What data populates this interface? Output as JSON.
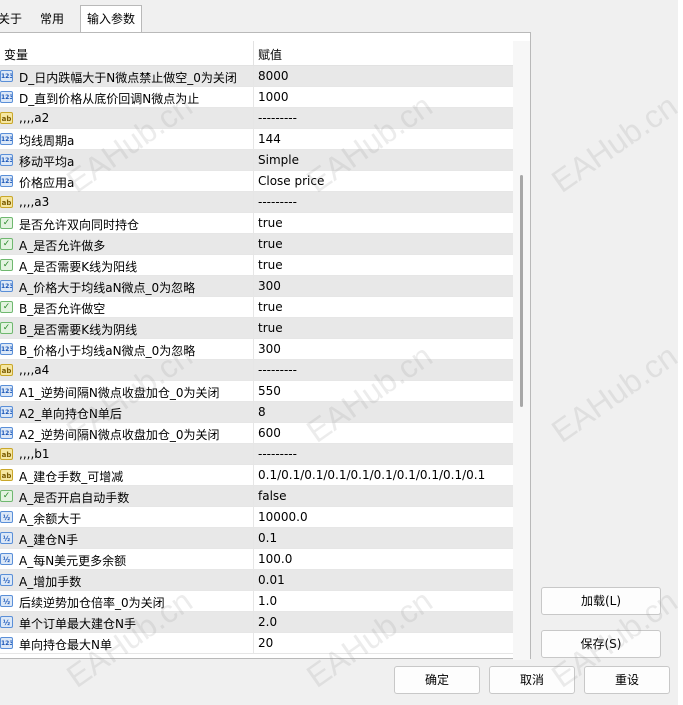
{
  "tabs": [
    {
      "label": "关于"
    },
    {
      "label": "常用"
    },
    {
      "label": "输入参数"
    }
  ],
  "table": {
    "header_variable": "变量",
    "header_value": "赋值",
    "rows": [
      {
        "type": "int",
        "icon": "123",
        "name": "D_日内跌幅大于N微点禁止做空_0为关闭",
        "value": "8000"
      },
      {
        "type": "int",
        "icon": "123",
        "name": "D_直到价格从底价回调N微点为止",
        "value": "1000"
      },
      {
        "type": "str",
        "icon": "ab",
        "name": ",,,,a2",
        "value": "---------"
      },
      {
        "type": "int",
        "icon": "123",
        "name": "均线周期a",
        "value": "144"
      },
      {
        "type": "int",
        "icon": "123",
        "name": "移动平均a",
        "value": "Simple"
      },
      {
        "type": "int",
        "icon": "123",
        "name": "价格应用a",
        "value": "Close price"
      },
      {
        "type": "str",
        "icon": "ab",
        "name": ",,,,a3",
        "value": "---------"
      },
      {
        "type": "bool",
        "icon": "✓",
        "name": "是否允许双向同时持仓",
        "value": "true"
      },
      {
        "type": "bool",
        "icon": "✓",
        "name": "A_是否允许做多",
        "value": "true"
      },
      {
        "type": "bool",
        "icon": "✓",
        "name": "A_是否需要K线为阳线",
        "value": "true"
      },
      {
        "type": "int",
        "icon": "123",
        "name": "A_价格大于均线aN微点_0为忽略",
        "value": "300"
      },
      {
        "type": "bool",
        "icon": "✓",
        "name": "B_是否允许做空",
        "value": "true"
      },
      {
        "type": "bool",
        "icon": "✓",
        "name": "B_是否需要K线为阴线",
        "value": "true"
      },
      {
        "type": "int",
        "icon": "123",
        "name": "B_价格小于均线aN微点_0为忽略",
        "value": "300"
      },
      {
        "type": "str",
        "icon": "ab",
        "name": ",,,,a4",
        "value": "---------"
      },
      {
        "type": "int",
        "icon": "123",
        "name": "A1_逆势间隔N微点收盘加仓_0为关闭",
        "value": "550"
      },
      {
        "type": "int",
        "icon": "123",
        "name": "A2_单向持仓N单后",
        "value": "8"
      },
      {
        "type": "int",
        "icon": "123",
        "name": "A2_逆势间隔N微点收盘加仓_0为关闭",
        "value": "600"
      },
      {
        "type": "str",
        "icon": "ab",
        "name": ",,,,b1",
        "value": "---------"
      },
      {
        "type": "str",
        "icon": "ab",
        "name": "A_建仓手数_可增减",
        "value": "0.1/0.1/0.1/0.1/0.1/0.1/0.1/0.1/0.1/0.1"
      },
      {
        "type": "bool",
        "icon": "✓",
        "name": "A_是否开启自动手数",
        "value": "false"
      },
      {
        "type": "dbl",
        "icon": "½",
        "name": "A_余额大于",
        "value": "10000.0"
      },
      {
        "type": "dbl",
        "icon": "½",
        "name": "A_建仓N手",
        "value": "0.1"
      },
      {
        "type": "dbl",
        "icon": "½",
        "name": "A_每N美元更多余额",
        "value": "100.0"
      },
      {
        "type": "dbl",
        "icon": "½",
        "name": "A_增加手数",
        "value": "0.01"
      },
      {
        "type": "dbl",
        "icon": "½",
        "name": "后续逆势加仓倍率_0为关闭",
        "value": "1.0"
      },
      {
        "type": "dbl",
        "icon": "½",
        "name": "单个订单最大建仓N手",
        "value": "2.0"
      },
      {
        "type": "int",
        "icon": "123",
        "name": "单向持仓最大N单",
        "value": "20"
      }
    ]
  },
  "buttons": {
    "load": "加载(L)",
    "save": "保存(S)",
    "ok": "确定",
    "cancel": "取消",
    "reset": "重设"
  },
  "watermark": "EAHub.cn"
}
